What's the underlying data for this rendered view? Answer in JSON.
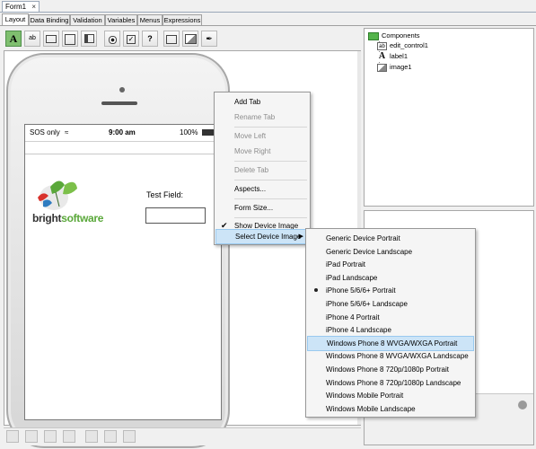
{
  "document_tab": {
    "title": "Form1",
    "close": "×"
  },
  "mode_tabs": [
    "Layout",
    "Data Binding",
    "Validation",
    "Variables",
    "Menus",
    "Expressions"
  ],
  "toolbar": {
    "tools": [
      "text-tool",
      "edit-field-tool",
      "button-tool",
      "list-tool",
      "form-tool",
      "radio-tool",
      "checkbox-tool",
      "help-tool",
      "image-button-tool",
      "image-tool",
      "signature-tool"
    ],
    "text_tool_glyph": "A",
    "edit_tool_glyph": "ab"
  },
  "phone": {
    "carrier": "SOS only",
    "time": "9:00 am",
    "battery": "100%",
    "logo_text_bright": "bright",
    "logo_text_software": "software",
    "field_label": "Test Field:"
  },
  "components": {
    "root": "Components",
    "items": [
      {
        "name": "edit_control1",
        "icon": "ab"
      },
      {
        "name": "label1",
        "icon": "A"
      },
      {
        "name": "image1",
        "icon": "img"
      }
    ]
  },
  "context_menu": {
    "items": [
      {
        "label": "Add Tab",
        "enabled": true
      },
      {
        "label": "Rename Tab",
        "enabled": false
      },
      {
        "label": "Move Left",
        "enabled": false
      },
      {
        "label": "Move Right",
        "enabled": false
      },
      {
        "label": "Delete Tab",
        "enabled": false
      },
      {
        "label": "Aspects...",
        "enabled": true
      },
      {
        "label": "Form Size...",
        "enabled": true
      },
      {
        "label": "Show Device Image",
        "enabled": true,
        "checked": true
      },
      {
        "label": "Select Device Image",
        "enabled": true,
        "submenu": true,
        "highlighted": true
      }
    ]
  },
  "submenu": {
    "items": [
      {
        "label": "Generic Device Portrait"
      },
      {
        "label": "Generic Device Landscape"
      },
      {
        "label": "iPad Portrait"
      },
      {
        "label": "iPad Landscape"
      },
      {
        "label": "iPhone 5/6/6+ Portrait",
        "selected": true
      },
      {
        "label": "iPhone 5/6/6+ Landscape"
      },
      {
        "label": "iPhone 4 Portrait"
      },
      {
        "label": "iPhone 4 Landscape"
      },
      {
        "label": "Windows Phone 8 WVGA/WXGA Portrait",
        "highlighted": true
      },
      {
        "label": "Windows Phone 8 WVGA/WXGA Landscape"
      },
      {
        "label": "Windows Phone 8 720p/1080p Portrait"
      },
      {
        "label": "Windows Phone 8 720p/1080p Landscape"
      },
      {
        "label": "Windows Mobile Portrait"
      },
      {
        "label": "Windows Mobile Landscape"
      }
    ]
  },
  "colors": {
    "menu_highlight": "#cce4f7",
    "toolbar_active": "#7fbf6f",
    "logo_green": "#5aa83a",
    "logo_red": "#d8312b",
    "logo_blue": "#2f7cc0"
  }
}
